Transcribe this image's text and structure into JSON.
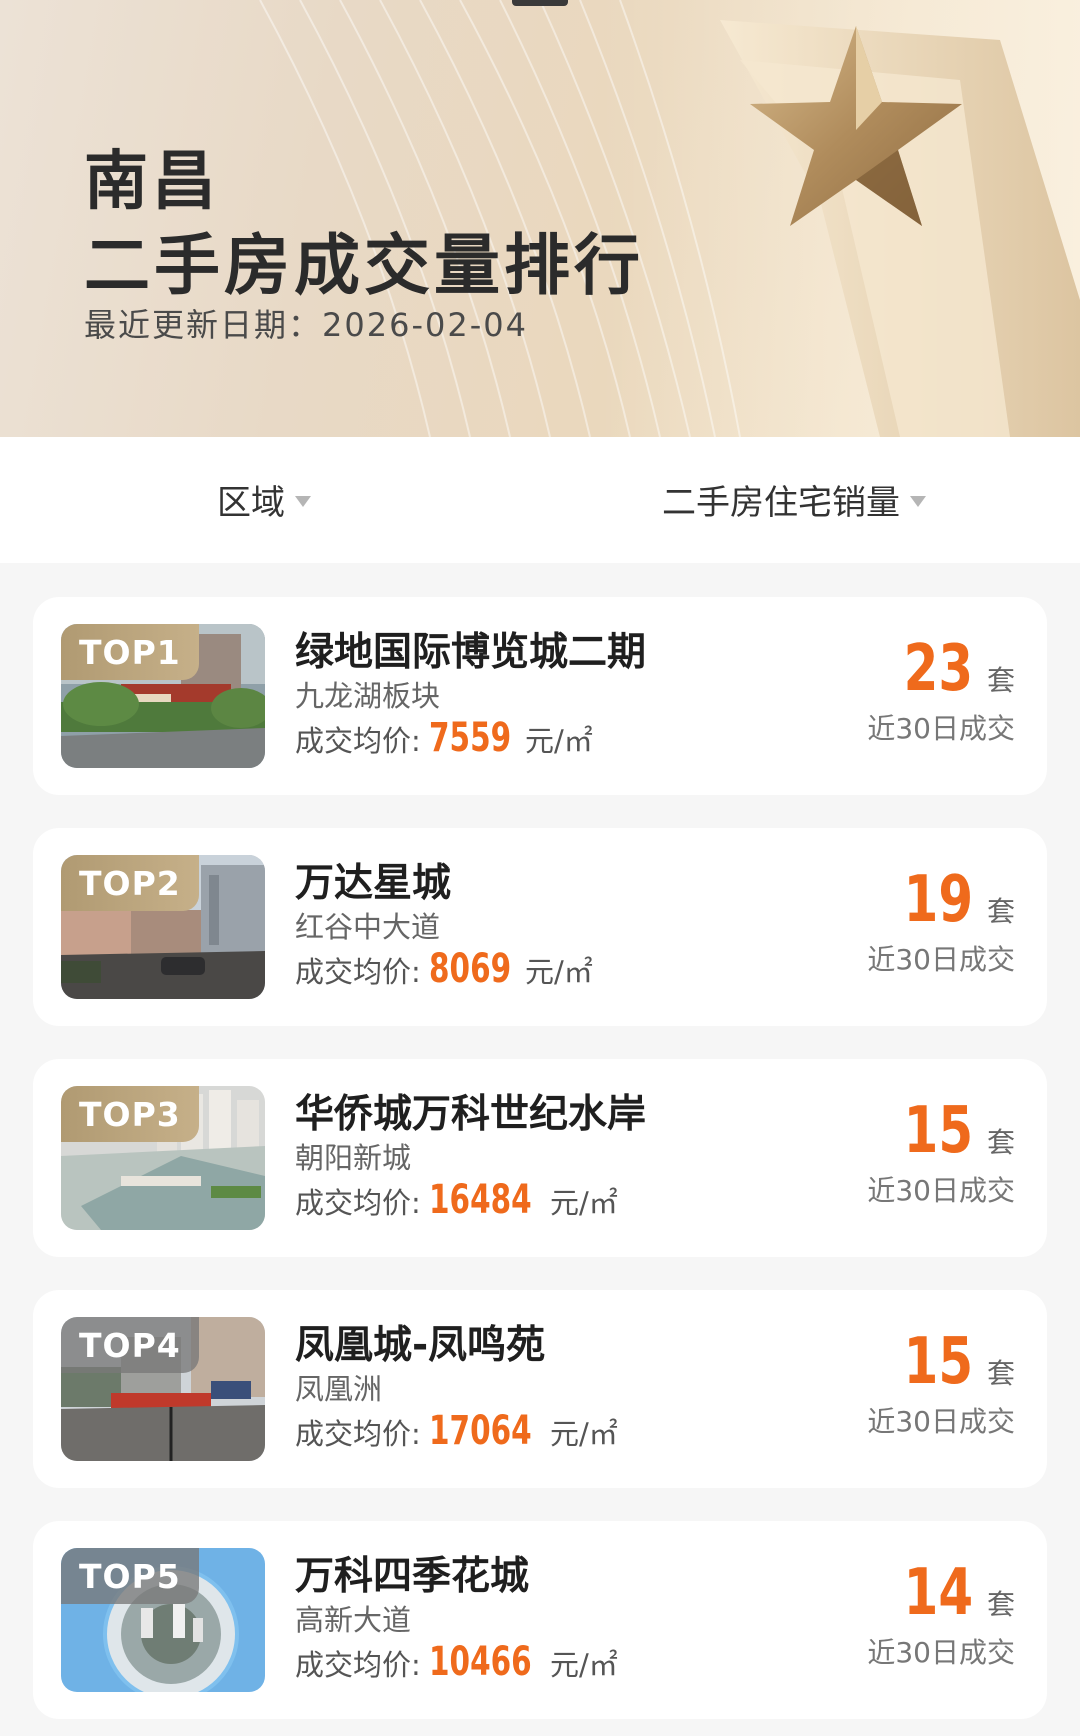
{
  "header": {
    "city": "南昌",
    "title": "二手房成交量排行",
    "update_label": "最近更新日期：",
    "update_date": "2026-02-04"
  },
  "filters": {
    "area": "区域",
    "metric": "二手房住宅销量"
  },
  "list": {
    "price_label": "成交均价",
    "price_colon": ":",
    "price_unit": "元/㎡",
    "count_unit": "套",
    "count_sub": "近30日成交",
    "items": [
      {
        "rank": "TOP1",
        "name": "绿地国际博览城二期",
        "district": "九龙湖板块",
        "price": "7559",
        "count": "23",
        "badge_color": "#b8a27a"
      },
      {
        "rank": "TOP2",
        "name": "万达星城",
        "district": "红谷中大道",
        "price": "8069",
        "count": "19",
        "badge_color": "#b8a27a"
      },
      {
        "rank": "TOP3",
        "name": "华侨城万科世纪水岸",
        "district": "朝阳新城",
        "price": "16484",
        "count": "15",
        "badge_color": "#b8a27a"
      },
      {
        "rank": "TOP4",
        "name": "凤凰城-凤鸣苑",
        "district": "凤凰洲",
        "price": "17064",
        "count": "15",
        "badge_color": "#7d7d7d"
      },
      {
        "rank": "TOP5",
        "name": "万科四季花城",
        "district": "高新大道",
        "price": "10466",
        "count": "14",
        "badge_color": "#7d7d7d"
      }
    ]
  },
  "colors": {
    "accent": "#ef6a1c",
    "card_bg": "#ffffff",
    "page_bg": "#f6f6f6",
    "hero_bg": "#ead8bd"
  }
}
